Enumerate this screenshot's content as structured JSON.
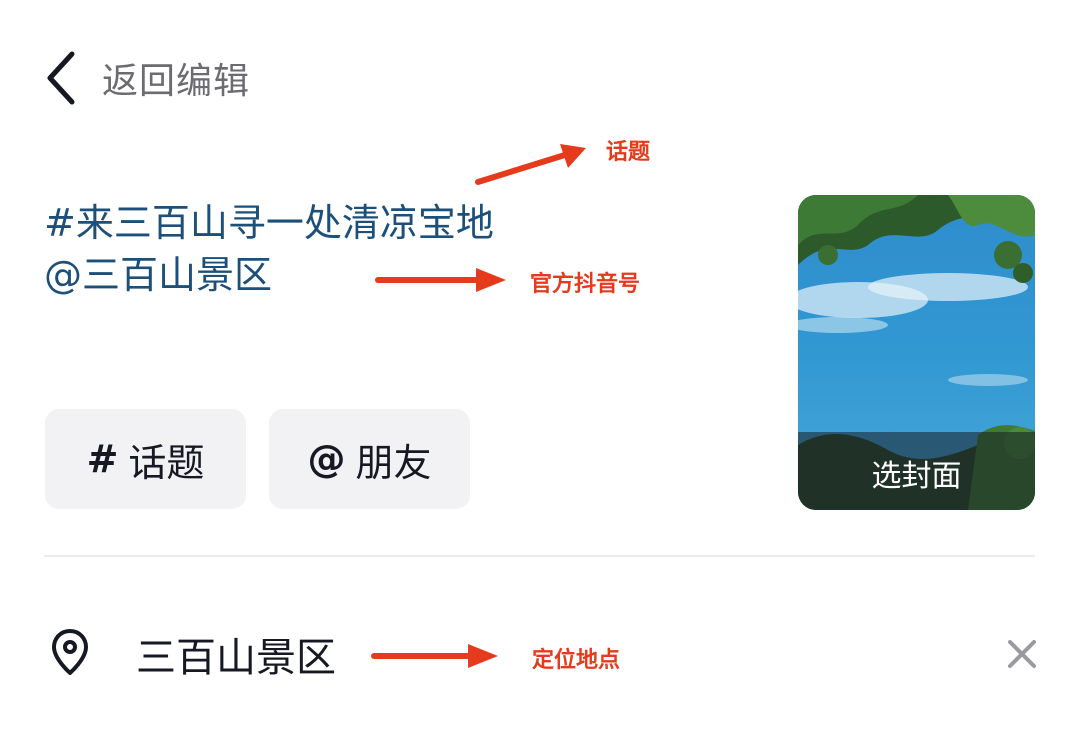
{
  "header": {
    "back_label": "返回编辑",
    "back_icon": "chevron-left-icon"
  },
  "caption": {
    "topic_line": "#来三百山寻一处清凉宝地",
    "mention_line": "@三百山景区"
  },
  "annotations": {
    "topic": "话题",
    "official_account": "官方抖音号",
    "location": "定位地点",
    "color": "#e63a1c"
  },
  "chips": [
    {
      "symbol": "#",
      "label": "话题"
    },
    {
      "symbol": "@",
      "label": "朋友"
    }
  ],
  "cover": {
    "label": "选封面"
  },
  "location": {
    "icon": "map-pin-icon",
    "label": "三百山景区",
    "clear_icon": "close-icon"
  },
  "colors": {
    "caption_text": "#1c4f7a",
    "chip_background": "#f2f2f4",
    "primary_text": "#161823"
  }
}
